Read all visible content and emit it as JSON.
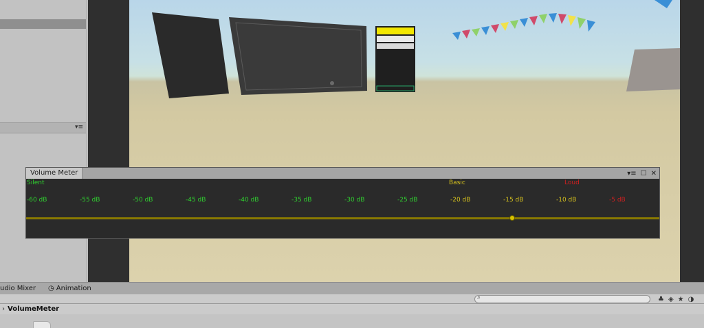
{
  "volume_meter": {
    "tab_title": "Volume Meter",
    "zones": [
      {
        "label": "Silent",
        "color": "#2fd12f"
      },
      {
        "label": "Basic",
        "color": "#d6c21e"
      },
      {
        "label": "Loud",
        "color": "#d02020"
      }
    ],
    "db_labels": [
      {
        "text": "-60 dB",
        "color": "#2fd12f"
      },
      {
        "text": "-55 dB",
        "color": "#2fd12f"
      },
      {
        "text": "-50 dB",
        "color": "#2fd12f"
      },
      {
        "text": "-45 dB",
        "color": "#2fd12f"
      },
      {
        "text": "-40 dB",
        "color": "#2fd12f"
      },
      {
        "text": "-35 dB",
        "color": "#2fd12f"
      },
      {
        "text": "-30 dB",
        "color": "#2fd12f"
      },
      {
        "text": "-25 dB",
        "color": "#2fd12f"
      },
      {
        "text": "-20 dB",
        "color": "#d6c21e"
      },
      {
        "text": "-15 dB",
        "color": "#d6c21e"
      },
      {
        "text": "-10 dB",
        "color": "#d6c21e"
      },
      {
        "text": "-5 dB",
        "color": "#d02020"
      }
    ],
    "current_level_db": -15,
    "track_color": "#8a7a00",
    "thumb_color": "#d8c200"
  },
  "bottom_tabs": {
    "audio_mixer": "udio Mixer",
    "animation": "Animation"
  },
  "toolbar": {
    "search_placeholder": ""
  },
  "breadcrumb": {
    "current": "VolumeMeter"
  },
  "icons": {
    "window_menu": "window-menu-icon",
    "maximize": "maximize-icon",
    "close": "close-icon",
    "search": "search-icon",
    "clock": "clock-icon"
  }
}
